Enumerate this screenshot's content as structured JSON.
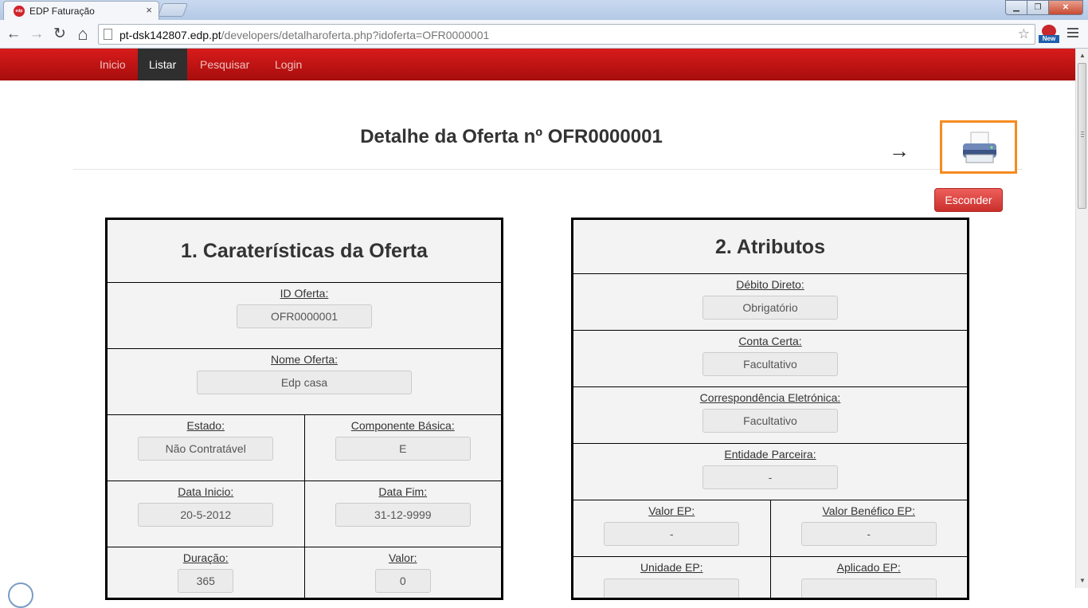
{
  "browser": {
    "tab_title": "EDP Faturação",
    "tab_favicon_text": "edp",
    "tab_close": "×",
    "url_host": "pt-dsk142807.edp.pt",
    "url_path": "/developers/detalharoferta.php?idoferta=OFR0000001",
    "extension_badge": "New",
    "icons": {
      "back": "←",
      "forward": "→",
      "reload": "↻",
      "home": "⌂",
      "star": "☆",
      "minimize": "▁",
      "maximize": "❐",
      "close": "✕"
    }
  },
  "navbar": {
    "items": [
      "Inicio",
      "Listar",
      "Pesquisar",
      "Login"
    ],
    "active": "Listar"
  },
  "page": {
    "title": "Detalhe da Oferta nº OFR0000001",
    "arrow": "→",
    "hide_button": "Esconder",
    "accent_color": "#f68b1f"
  },
  "panel1": {
    "title": "1. Caraterísticas da Oferta",
    "id_label": "ID Oferta:",
    "id_value": "OFR0000001",
    "name_label": "Nome Oferta:",
    "name_value": "Edp casa",
    "estado_label": "Estado:",
    "estado_value": "Não Contratável",
    "componente_label": "Componente Básica:",
    "componente_value": "E",
    "data_inicio_label": "Data Inicio:",
    "data_inicio_value": "20-5-2012",
    "data_fim_label": "Data Fim:",
    "data_fim_value": "31-12-9999",
    "duracao_label": "Duração:",
    "duracao_value": "365",
    "valor_label": "Valor:",
    "valor_value": "0"
  },
  "panel2": {
    "title": "2. Atributos",
    "debito_label": "Débito Direto:",
    "debito_value": "Obrigatório",
    "conta_label": "Conta Certa:",
    "conta_value": "Facultativo",
    "corresp_label": "Correspondência Eletrónica:",
    "corresp_value": "Facultativo",
    "entidade_label": "Entidade Parceira:",
    "entidade_value": "-",
    "valor_ep_label": "Valor EP:",
    "valor_ep_value": "-",
    "valor_benef_label": "Valor Benéfico EP:",
    "valor_benef_value": "-",
    "unidade_ep_label": "Unidade EP:",
    "aplicado_ep_label": "Aplicado EP:"
  }
}
